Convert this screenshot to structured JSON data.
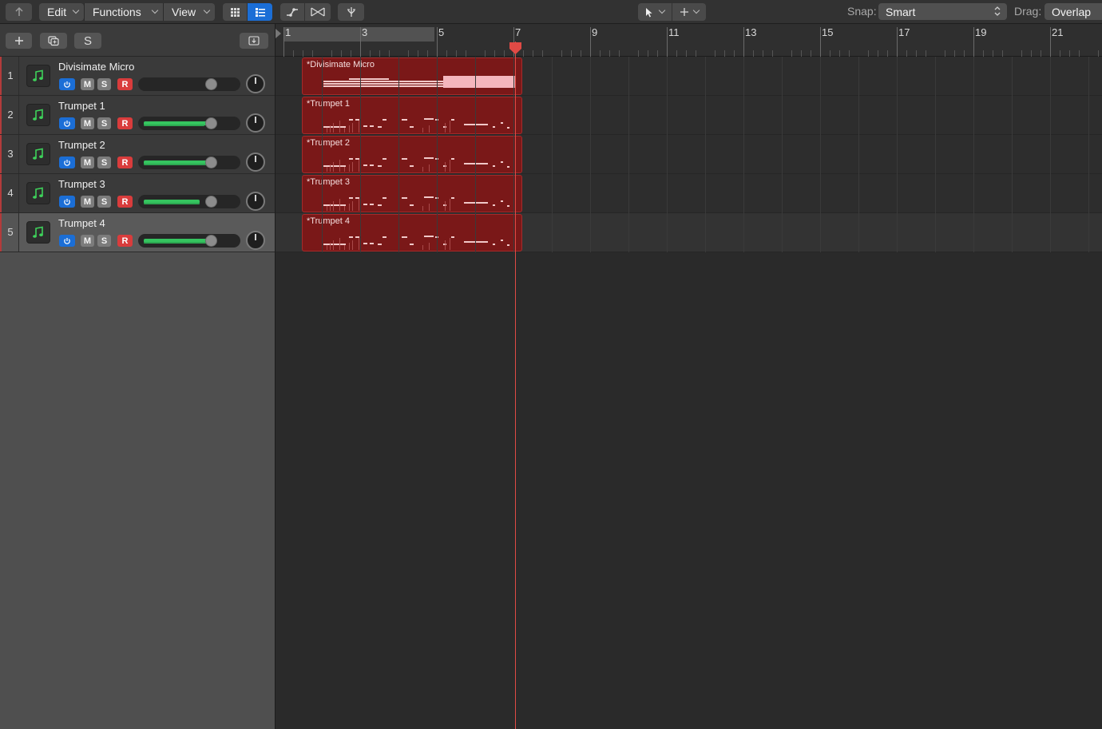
{
  "toolbar": {
    "menus": [
      {
        "label": "Edit"
      },
      {
        "label": "Functions"
      },
      {
        "label": "View"
      }
    ],
    "snap_label": "Snap:",
    "snap_value": "Smart",
    "drag_label": "Drag:",
    "drag_value": "Overlap"
  },
  "track_header": {
    "s_label": "S"
  },
  "tracks": [
    {
      "number": "1",
      "name": "Divisimate Micro",
      "mute": "M",
      "solo": "S",
      "record": "R",
      "volume_fraction": 0.0,
      "selected": false
    },
    {
      "number": "2",
      "name": "Trumpet 1",
      "mute": "M",
      "solo": "S",
      "record": "R",
      "volume_fraction": 0.78,
      "selected": false
    },
    {
      "number": "3",
      "name": "Trumpet 2",
      "mute": "M",
      "solo": "S",
      "record": "R",
      "volume_fraction": 0.78,
      "selected": false
    },
    {
      "number": "4",
      "name": "Trumpet 3",
      "mute": "M",
      "solo": "S",
      "record": "R",
      "volume_fraction": 0.68,
      "selected": false
    },
    {
      "number": "5",
      "name": "Trumpet 4",
      "mute": "M",
      "solo": "S",
      "record": "R",
      "volume_fraction": 0.78,
      "selected": true
    }
  ],
  "ruler": {
    "bars": [
      "1",
      "3",
      "5",
      "7",
      "9",
      "11",
      "13",
      "15",
      "17",
      "19",
      "21"
    ],
    "playhead_bar": 7
  },
  "regions": [
    {
      "name": "*Divisimate Micro"
    },
    {
      "name": "*Trumpet 1"
    },
    {
      "name": "*Trumpet 2"
    },
    {
      "name": "*Trumpet 3"
    },
    {
      "name": "*Trumpet 4"
    }
  ],
  "colors": {
    "region_fill": "#7a1818",
    "playhead": "#e04a45",
    "accent_blue": "#1b6ed6",
    "record_red": "#d93c3c",
    "volume_green": "#35c45f",
    "instrument_icon_green": "#3ed15a"
  }
}
